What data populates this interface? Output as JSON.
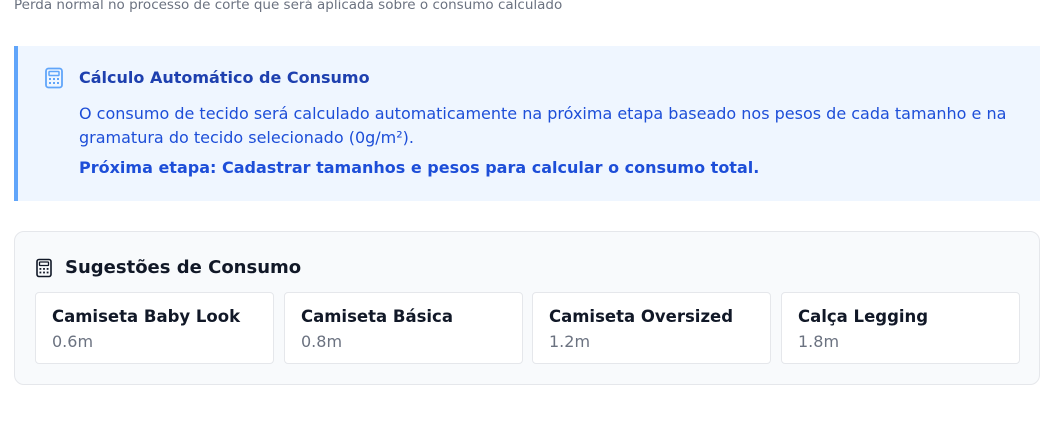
{
  "helper_text": "Perda normal no processo de corte que será aplicada sobre o consumo calculado",
  "info": {
    "icon": "calculator-icon",
    "title": "Cálculo Automático de Consumo",
    "body": "O consumo de tecido será calculado automaticamente na próxima etapa baseado nos pesos de cada tamanho e na gramatura do tecido selecionado (0g/m²).",
    "next_step": "Próxima etapa: Cadastrar tamanhos e pesos para calcular o consumo total.",
    "accent_color": "#60a5fa",
    "background": "#eff6ff"
  },
  "suggestions": {
    "icon": "calculator-icon",
    "title": "Sugestões de Consumo",
    "items": [
      {
        "name": "Camiseta Baby Look",
        "value": "0.6m"
      },
      {
        "name": "Camiseta Básica",
        "value": "0.8m"
      },
      {
        "name": "Camiseta Oversized",
        "value": "1.2m"
      },
      {
        "name": "Calça Legging",
        "value": "1.8m"
      }
    ]
  }
}
